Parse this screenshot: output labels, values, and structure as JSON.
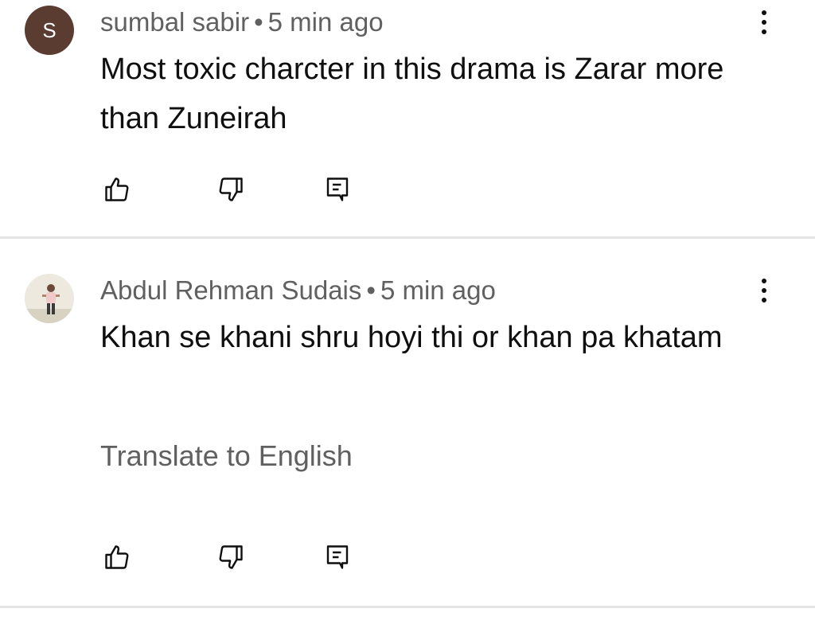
{
  "comments": [
    {
      "avatar_letter": "S",
      "author": "sumbal sabir",
      "separator": "•",
      "time": "5 min ago",
      "text": "Most toxic charcter in this drama is Zarar more than Zuneirah"
    },
    {
      "author": "Abdul Rehman Sudais",
      "separator": "•",
      "time": "5 min ago",
      "text": "Khan se khani shru hoyi thi or khan pa khatam",
      "translate_label": "Translate to English"
    }
  ],
  "icons": {
    "like": "thumbs-up-icon",
    "dislike": "thumbs-down-icon",
    "reply": "reply-icon",
    "menu": "more-vert-icon"
  },
  "colors": {
    "avatar_bg": "#5b3c31",
    "meta_text": "#606060",
    "body_text": "#0f0f0f",
    "divider": "#e5e5e5"
  }
}
